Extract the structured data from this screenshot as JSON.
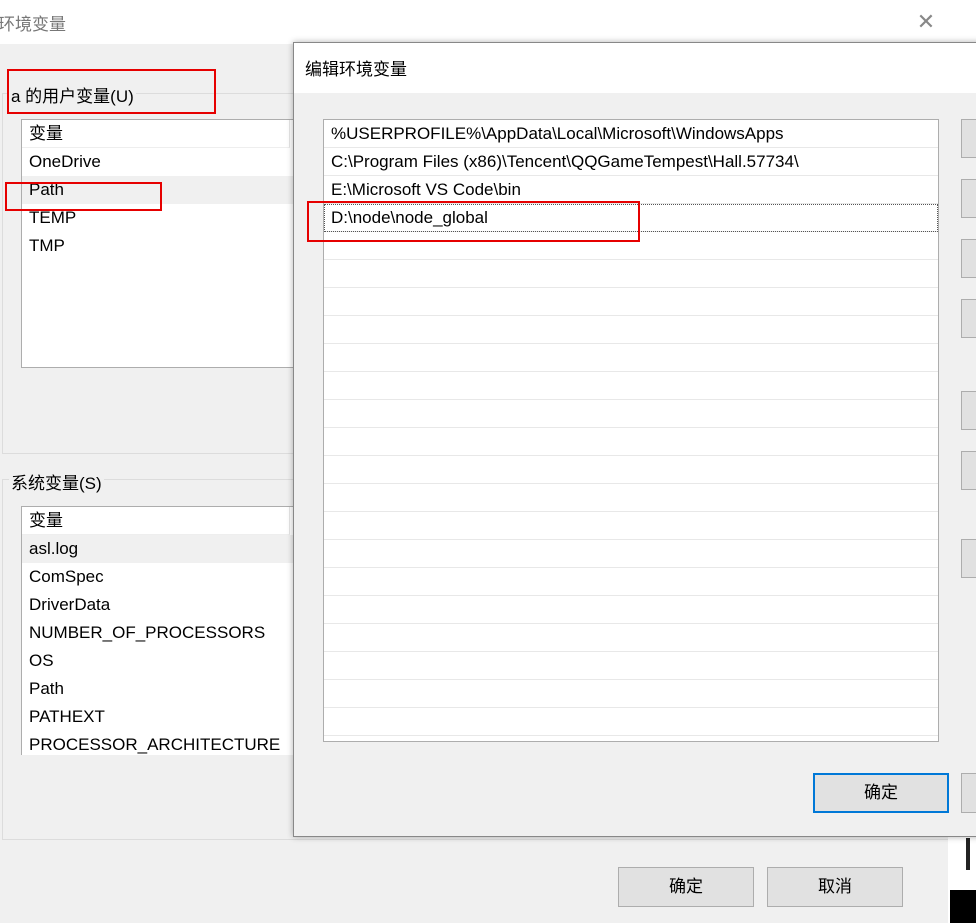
{
  "background_dialog": {
    "title": "环境变量",
    "close_icon": "close-icon",
    "user_group_label": "a 的用户变量(U)",
    "user_list": {
      "header": "变量",
      "items": [
        "OneDrive",
        "Path",
        "TEMP",
        "TMP"
      ],
      "selected": "Path"
    },
    "system_group_label": "系统变量(S)",
    "system_list": {
      "header": "变量",
      "items": [
        "asl.log",
        "ComSpec",
        "DriverData",
        "NUMBER_OF_PROCESSORS",
        "OS",
        "Path",
        "PATHEXT",
        "PROCESSOR_ARCHITECTURE"
      ],
      "selected": "asl.log"
    },
    "ok_label": "确定",
    "cancel_label": "取消"
  },
  "edit_dialog": {
    "title": "编辑环境变量",
    "entries": [
      "%USERPROFILE%\\AppData\\Local\\Microsoft\\WindowsApps",
      "C:\\Program Files (x86)\\Tencent\\QQGameTempest\\Hall.57734\\",
      "E:\\Microsoft VS Code\\bin",
      "D:\\node\\node_global"
    ],
    "selected_index": 3,
    "ok_label": "确定"
  },
  "annotation_color": "#e60000",
  "accent_color": "#0078d7"
}
